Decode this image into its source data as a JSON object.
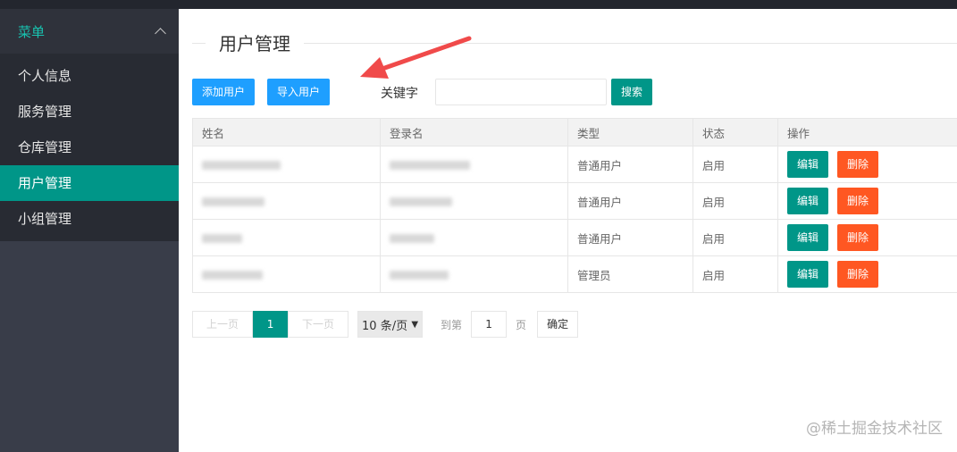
{
  "sidebar": {
    "header": {
      "label": "菜单"
    },
    "items": [
      {
        "label": "个人信息",
        "active": false
      },
      {
        "label": "服务管理",
        "active": false
      },
      {
        "label": "仓库管理",
        "active": false
      },
      {
        "label": "用户管理",
        "active": true
      },
      {
        "label": "小组管理",
        "active": false
      }
    ]
  },
  "page": {
    "title": "用户管理"
  },
  "toolbar": {
    "add_label": "添加用户",
    "import_label": "导入用户",
    "keyword_label": "关键字",
    "keyword_value": "",
    "search_label": "搜索"
  },
  "table": {
    "columns": [
      "姓名",
      "登录名",
      "类型",
      "状态",
      "操作"
    ],
    "rows": [
      {
        "type": "普通用户",
        "status": "启用",
        "edit": "编辑",
        "delete": "删除"
      },
      {
        "type": "普通用户",
        "status": "启用",
        "edit": "编辑",
        "delete": "删除"
      },
      {
        "type": "普通用户",
        "status": "启用",
        "edit": "编辑",
        "delete": "删除"
      },
      {
        "type": "管理员",
        "status": "启用",
        "edit": "编辑",
        "delete": "删除"
      }
    ]
  },
  "pagination": {
    "prev_label": "上一页",
    "current_page": "1",
    "next_label": "下一页",
    "page_size": "10 条/页",
    "goto_label": "到第",
    "goto_value": "1",
    "page_unit": "页",
    "confirm_label": "确定"
  },
  "watermark": "@稀土掘金技术社区",
  "colors": {
    "sidebar_bg": "#393d49",
    "active_item": "#009688",
    "primary_blue": "#1e9fff",
    "danger": "#ff5722",
    "arrow": "#f04a4a"
  }
}
